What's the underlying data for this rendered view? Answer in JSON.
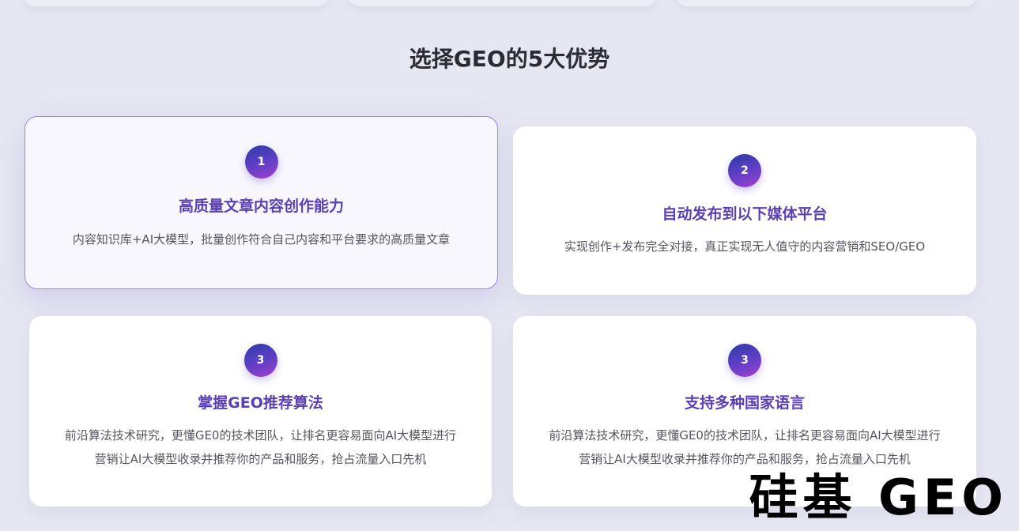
{
  "section": {
    "title": "选择GEO的5大优势"
  },
  "cards": [
    {
      "number": "1",
      "title": "高质量文章内容创作能力",
      "desc": [
        "内容知识库+AI大模型，批量创作符合自己内容和平台要求的高质量文章"
      ]
    },
    {
      "number": "2",
      "title": "自动发布到以下媒体平台",
      "desc": [
        "实现创作+发布完全对接，真正实现无人值守的内容营销和SEO/GEO"
      ]
    },
    {
      "number": "3",
      "title": "掌握GEO推荐算法",
      "desc": [
        "前沿算法技术研究，更懂GE0的技术团队，让排名更容易面向AI大模型进行",
        "营销让AI大模型收录并推荐你的产品和服务，抢占流量入口先机"
      ]
    },
    {
      "number": "3",
      "title": "支持多种国家语言",
      "desc": [
        "前沿算法技术研究，更懂GE0的技术团队，让排名更容易面向AI大模型进行",
        "营销让AI大模型收录并推荐你的产品和服务，抢占流量入口先机"
      ]
    }
  ],
  "watermark": "硅基 GEO"
}
